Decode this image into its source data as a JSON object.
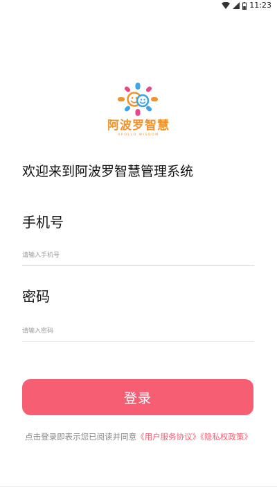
{
  "status_bar": {
    "time": "11:23",
    "icons": [
      "wifi-icon",
      "signal-icon",
      "battery-icon"
    ]
  },
  "logo": {
    "brand_text": "阿波罗智慧",
    "brand_subtext": "APOLLO WISDOM"
  },
  "welcome_text": "欢迎来到阿波罗智慧管理系统",
  "phone": {
    "label": "手机号",
    "placeholder": "请输入手机号",
    "value": ""
  },
  "password": {
    "label": "密码",
    "placeholder": "请输入密码",
    "value": ""
  },
  "login_button_label": "登录",
  "agreement": {
    "prefix": "点击登录即表示您已阅读并同意",
    "user_agreement": "《用户服务协议》",
    "privacy_policy": "《隐私权政策》"
  },
  "colors": {
    "accent": "#f65e74",
    "brand_orange": "#f0932b",
    "brand_blue": "#3da5e6",
    "brand_pink": "#e8458a"
  }
}
